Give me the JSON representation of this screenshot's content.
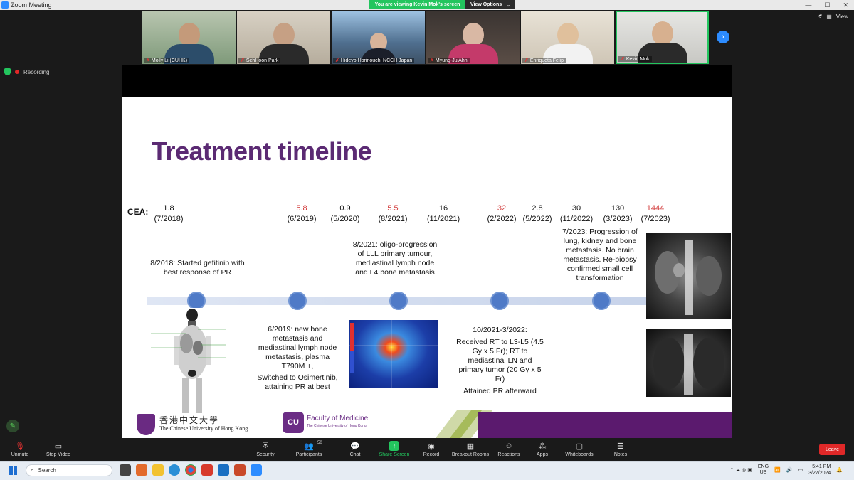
{
  "window": {
    "title": "Zoom Meeting",
    "share_banner": "You are viewing Kevin Mok's screen",
    "view_options": "View Options",
    "view_label": "View"
  },
  "participants": [
    {
      "name": "Molly Li (CUHK)"
    },
    {
      "name": "SehHoon Park"
    },
    {
      "name": "Hideyo Horinouchi NCCH Japan"
    },
    {
      "name": "Myung-Ju Ahn"
    },
    {
      "name": "Enriqueta Felip"
    },
    {
      "name": "Kevin Mok"
    }
  ],
  "recording": {
    "label": "Recording"
  },
  "slide": {
    "title": "Treatment timeline",
    "cea_label": "CEA:",
    "cea": [
      {
        "value": "1.8",
        "date": "(7/2018)",
        "red": false
      },
      {
        "value": "5.8",
        "date": "(6/2019)",
        "red": true
      },
      {
        "value": "0.9",
        "date": "(5/2020)",
        "red": false
      },
      {
        "value": "5.5",
        "date": "(8/2021)",
        "red": true
      },
      {
        "value": "16",
        "date": "(11/2021)",
        "red": false
      },
      {
        "value": "32",
        "date": "(2/2022)",
        "red": true
      },
      {
        "value": "2.8",
        "date": "(5/2022)",
        "red": false
      },
      {
        "value": "30",
        "date": "(11/2022)",
        "red": false
      },
      {
        "value": "130",
        "date": "(3/2023)",
        "red": false
      },
      {
        "value": "1444",
        "date": "(7/2023)",
        "red": true
      }
    ],
    "notes": {
      "n1": "8/2018: Started gefitinib with best response of PR",
      "n2": "6/2019: new bone metastasis and mediastinal lymph node metastasis, plasma T790M +,",
      "n2b": "Switched to Osimertinib, attaining PR at best",
      "n3": "8/2021: oligo-progression of LLL primary tumour, mediastinal lymph node and L4 bone metastasis",
      "n4": "10/2021-3/2022:",
      "n4b": "Received RT to L3-L5 (4.5 Gy x 5 Fr); RT to mediastinal LN and primary tumor (20 Gy x 5 Fr)",
      "n4c": "Attained PR afterward",
      "n5": "7/2023: Progression of lung, kidney and bone metastasis. No brain metastasis. Re-biopsy confirmed small cell transformation"
    },
    "logos": {
      "cuhk_zh": "香港中文大學",
      "cuhk_en": "The Chinese University of Hong Kong",
      "fom_badge": "CU",
      "fom_title": "Faculty of Medicine",
      "fom_sub": "The Chinese University of Hong Kong"
    }
  },
  "toolbar": {
    "unmute": "Unmute",
    "stop_video": "Stop Video",
    "security": "Security",
    "participants": "Participants",
    "participants_count": "50",
    "chat": "Chat",
    "share_screen": "Share Screen",
    "record": "Record",
    "breakout": "Breakout Rooms",
    "reactions": "Reactions",
    "apps": "Apps",
    "whiteboards": "Whiteboards",
    "notes": "Notes",
    "leave": "Leave"
  },
  "taskbar": {
    "search": "Search",
    "lang_top": "ENG",
    "lang_bottom": "US",
    "time": "5:41 PM",
    "date": "3/27/2024"
  }
}
